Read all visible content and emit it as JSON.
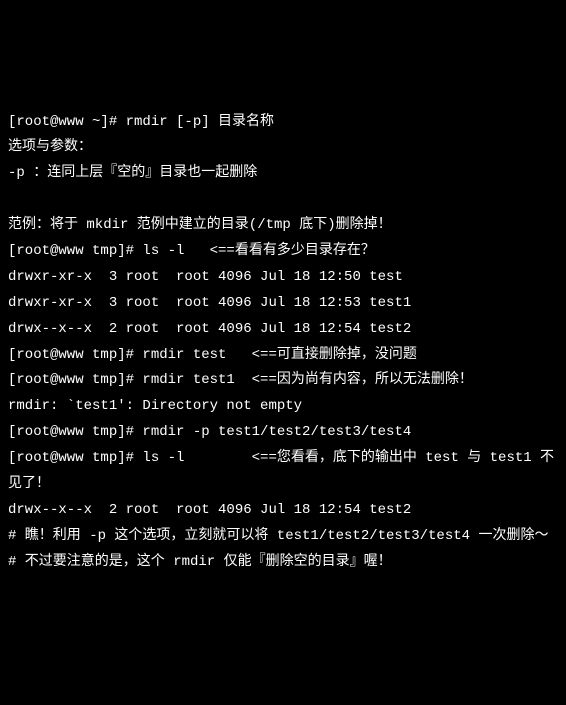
{
  "lines": [
    "[root@www ~]# rmdir [-p] 目录名称",
    "选项与参数：",
    "-p ：连同上层『空的』目录也一起删除",
    "",
    "范例：将于 mkdir 范例中建立的目录(/tmp 底下)删除掉！",
    "[root@www tmp]# ls -l   <==看看有多少目录存在？",
    "drwxr-xr-x  3 root  root 4096 Jul 18 12:50 test",
    "drwxr-xr-x  3 root  root 4096 Jul 18 12:53 test1",
    "drwx--x--x  2 root  root 4096 Jul 18 12:54 test2",
    "[root@www tmp]# rmdir test   <==可直接删除掉，没问题",
    "[root@www tmp]# rmdir test1  <==因为尚有内容，所以无法删除！",
    "rmdir: `test1': Directory not empty",
    "[root@www tmp]# rmdir -p test1/test2/test3/test4",
    "[root@www tmp]# ls -l        <==您看看，底下的输出中 test 与 test1 不见了！",
    "drwx--x--x  2 root  root 4096 Jul 18 12:54 test2",
    "# 瞧！利用 -p 这个选项，立刻就可以将 test1/test2/test3/test4 一次删除～",
    "# 不过要注意的是，这个 rmdir 仅能『删除空的目录』喔！"
  ]
}
